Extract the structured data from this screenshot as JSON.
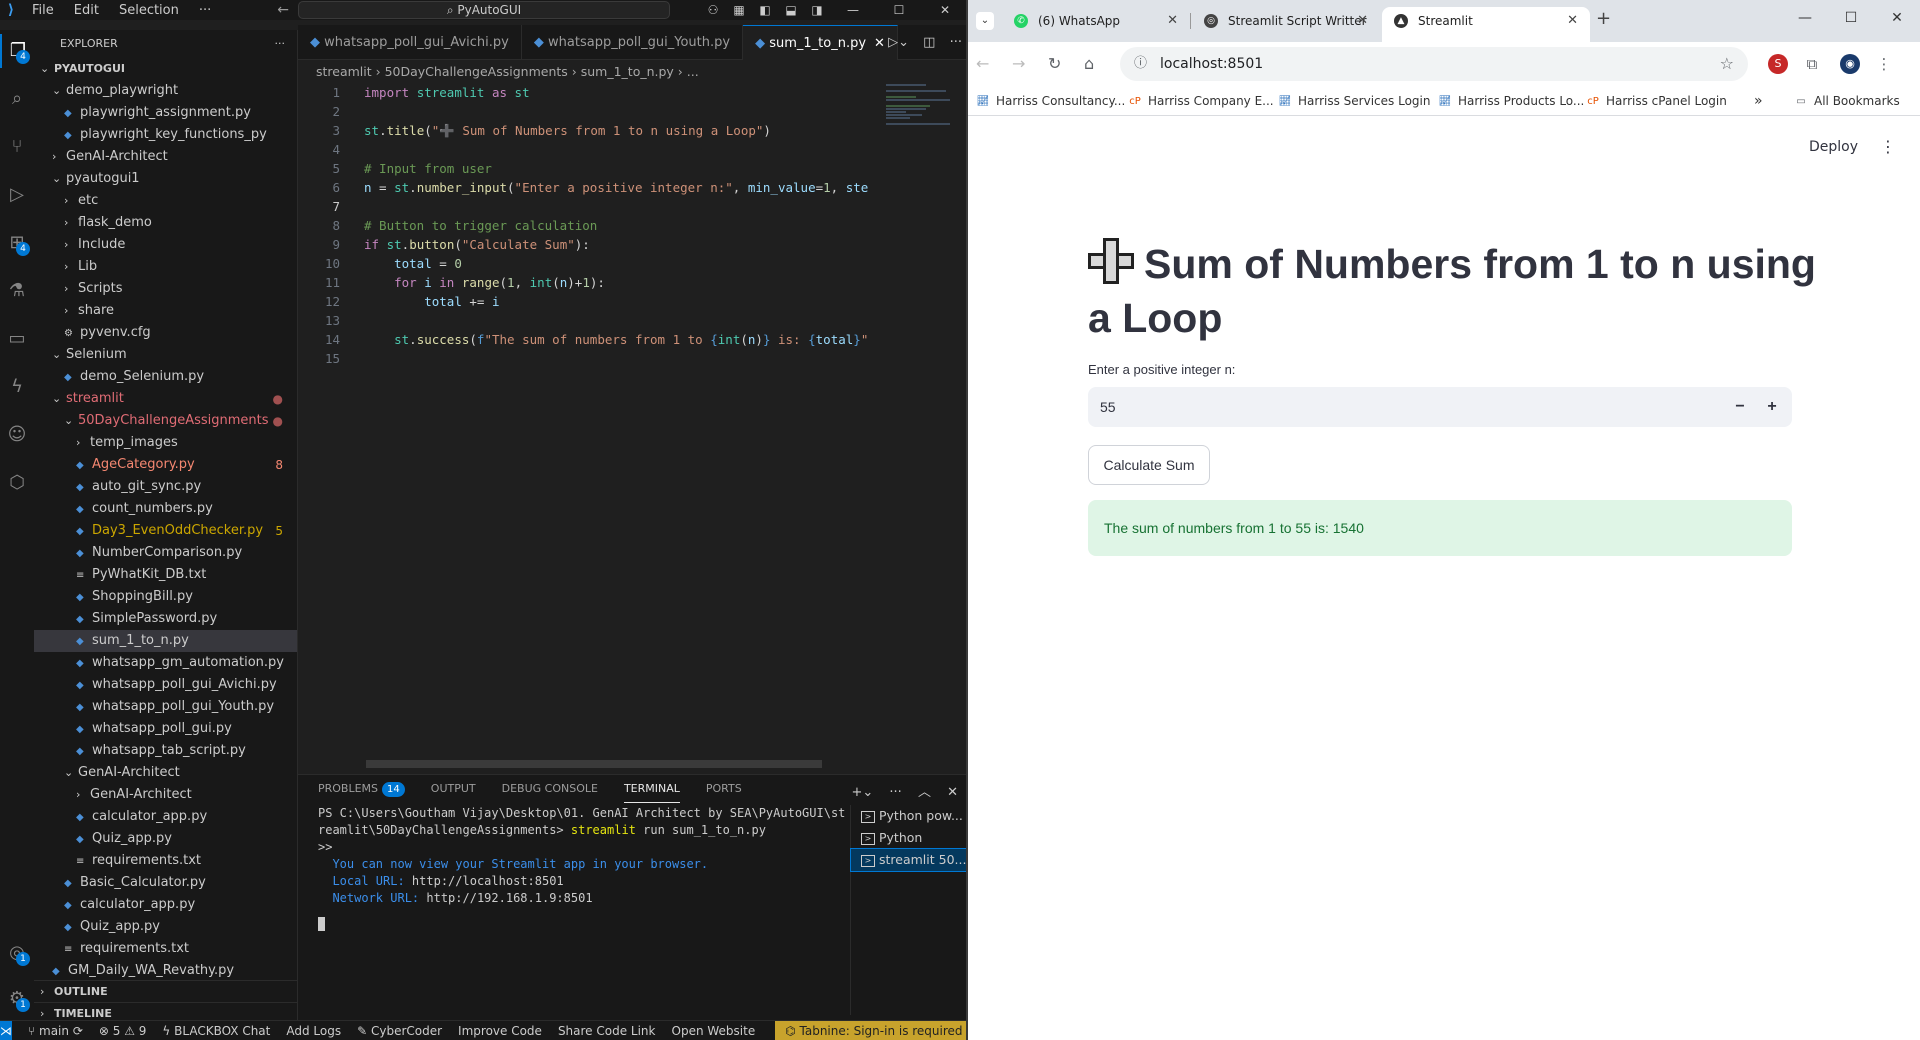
{
  "vscode": {
    "menu": [
      "File",
      "Edit",
      "Selection",
      "···"
    ],
    "command_center": "PyAutoGUI",
    "explorer": {
      "title": "EXPLORER",
      "root": "PYAUTOGUI",
      "rows": [
        {
          "label": "demo_playwright",
          "indent": 1,
          "type": "folder-open"
        },
        {
          "label": "playwright_assignment.py",
          "indent": 2,
          "type": "py"
        },
        {
          "label": "playwright_key_functions_py",
          "indent": 2,
          "type": "py"
        },
        {
          "label": "GenAI-Architect",
          "indent": 1,
          "type": "folder"
        },
        {
          "label": "pyautogui1",
          "indent": 1,
          "type": "folder-open"
        },
        {
          "label": "etc",
          "indent": 2,
          "type": "folder"
        },
        {
          "label": "flask_demo",
          "indent": 2,
          "type": "folder"
        },
        {
          "label": "Include",
          "indent": 2,
          "type": "folder"
        },
        {
          "label": "Lib",
          "indent": 2,
          "type": "folder"
        },
        {
          "label": "Scripts",
          "indent": 2,
          "type": "folder"
        },
        {
          "label": "share",
          "indent": 2,
          "type": "folder"
        },
        {
          "label": "pyvenv.cfg",
          "indent": 2,
          "type": "cfg"
        },
        {
          "label": "Selenium",
          "indent": 1,
          "type": "folder-open"
        },
        {
          "label": "demo_Selenium.py",
          "indent": 2,
          "type": "py"
        },
        {
          "label": "streamlit",
          "indent": 1,
          "type": "folder-open",
          "color": "#e06c75",
          "dot": true
        },
        {
          "label": "50DayChallengeAssignments",
          "indent": 2,
          "type": "folder-open",
          "color": "#e06c75",
          "dot": true
        },
        {
          "label": "temp_images",
          "indent": 3,
          "type": "folder"
        },
        {
          "label": "AgeCategory.py",
          "indent": 3,
          "type": "py",
          "color": "#f48771",
          "badge": "8",
          "badge_color": "#f48771"
        },
        {
          "label": "auto_git_sync.py",
          "indent": 3,
          "type": "py"
        },
        {
          "label": "count_numbers.py",
          "indent": 3,
          "type": "py"
        },
        {
          "label": "Day3_EvenOddChecker.py",
          "indent": 3,
          "type": "py",
          "color": "#cca700",
          "badge": "5",
          "badge_color": "#cca700"
        },
        {
          "label": "NumberComparison.py",
          "indent": 3,
          "type": "py"
        },
        {
          "label": "PyWhatKit_DB.txt",
          "indent": 3,
          "type": "txt"
        },
        {
          "label": "ShoppingBill.py",
          "indent": 3,
          "type": "py"
        },
        {
          "label": "SimplePassword.py",
          "indent": 3,
          "type": "py"
        },
        {
          "label": "sum_1_to_n.py",
          "indent": 3,
          "type": "py",
          "selected": true
        },
        {
          "label": "whatsapp_gm_automation.py",
          "indent": 3,
          "type": "py"
        },
        {
          "label": "whatsapp_poll_gui_Avichi.py",
          "indent": 3,
          "type": "py"
        },
        {
          "label": "whatsapp_poll_gui_Youth.py",
          "indent": 3,
          "type": "py"
        },
        {
          "label": "whatsapp_poll_gui.py",
          "indent": 3,
          "type": "py"
        },
        {
          "label": "whatsapp_tab_script.py",
          "indent": 3,
          "type": "py"
        },
        {
          "label": "GenAI-Architect",
          "indent": 2,
          "type": "folder-open"
        },
        {
          "label": "GenAI-Architect",
          "indent": 3,
          "type": "folder"
        },
        {
          "label": "calculator_app.py",
          "indent": 3,
          "type": "py"
        },
        {
          "label": "Quiz_app.py",
          "indent": 3,
          "type": "py"
        },
        {
          "label": "requirements.txt",
          "indent": 3,
          "type": "txt"
        },
        {
          "label": "Basic_Calculator.py",
          "indent": 2,
          "type": "py"
        },
        {
          "label": "calculator_app.py",
          "indent": 2,
          "type": "py"
        },
        {
          "label": "Quiz_app.py",
          "indent": 2,
          "type": "py"
        },
        {
          "label": "requirements.txt",
          "indent": 2,
          "type": "txt"
        },
        {
          "label": "GM_Daily_WA_Revathy.py",
          "indent": 1,
          "type": "py"
        }
      ],
      "outline": "OUTLINE",
      "timeline": "TIMELINE"
    },
    "tabs": [
      {
        "label": "whatsapp_poll_gui_Avichi.py",
        "active": false
      },
      {
        "label": "whatsapp_poll_gui_Youth.py",
        "active": false
      },
      {
        "label": "sum_1_to_n.py",
        "active": true
      }
    ],
    "breadcrumb": "streamlit  ›  50DayChallengeAssignments  ›  sum_1_to_n.py  ›  ...",
    "code_lines": [
      "import streamlit as st",
      "",
      "st.title(\"➕ Sum of Numbers from 1 to n using a Loop\")",
      "",
      "# Input from user",
      "n = st.number_input(\"Enter a positive integer n:\", min_value=1, ste",
      "",
      "# Button to trigger calculation",
      "if st.button(\"Calculate Sum\"):",
      "    total = 0",
      "    for i in range(1, int(n)+1):",
      "        total += i",
      "",
      "    st.success(f\"The sum of numbers from 1 to {int(n)} is: {total}\"",
      ""
    ],
    "panel": {
      "tabs": [
        "PROBLEMS",
        "OUTPUT",
        "DEBUG CONSOLE",
        "TERMINAL",
        "PORTS"
      ],
      "problems_count": "14",
      "active_tab": "TERMINAL",
      "terminal_lines": [
        "PS C:\\Users\\Goutham Vijay\\Desktop\\01. GenAI Architect by SEA\\PyAutoGUI\\st",
        "reamlit\\50DayChallengeAssignments> streamlit run sum_1_to_n.py",
        ">>",
        "",
        "  You can now view your Streamlit app in your browser.",
        "",
        "  Local URL: http://localhost:8501",
        "  Network URL: http://192.168.1.9:8501"
      ],
      "terminals": [
        {
          "label": "Python pow...",
          "active": false
        },
        {
          "label": "Python",
          "active": false
        },
        {
          "label": "streamlit 50...",
          "active": true
        }
      ]
    },
    "status": {
      "branch": "main",
      "problems": "⊗ 5 ⚠ 9",
      "items": [
        "BLACKBOX Chat",
        "Add Logs",
        "CyberCoder",
        "Improve Code",
        "Share Code Link",
        "Open Website"
      ],
      "tabnine": "Tabnine: Sign-in is required"
    },
    "activity_badges": {
      "explorer": "4",
      "extensions": "4",
      "accounts": "1",
      "settings": "1"
    }
  },
  "chrome": {
    "tabs": [
      {
        "label": "(6) WhatsApp",
        "active": false,
        "favicon_color": "#25d366"
      },
      {
        "label": "Streamlit Script Writter",
        "active": false,
        "favicon_color": "#444444"
      },
      {
        "label": "Streamlit",
        "active": true,
        "favicon_color": "#333333"
      }
    ],
    "url": "localhost:8501",
    "bookmarks": [
      "Harriss Consultancy...",
      "Harriss Company E...",
      "Harriss Services Login",
      "Harriss Products Lo...",
      "Harriss cPanel Login"
    ],
    "all_bookmarks": "All Bookmarks"
  },
  "streamlit": {
    "deploy": "Deploy",
    "title": "Sum of Numbers from 1 to n using a Loop",
    "input_label": "Enter a positive integer n:",
    "input_value": "55",
    "button": "Calculate Sum",
    "success": "The sum of numbers from 1 to 55 is: 1540"
  }
}
